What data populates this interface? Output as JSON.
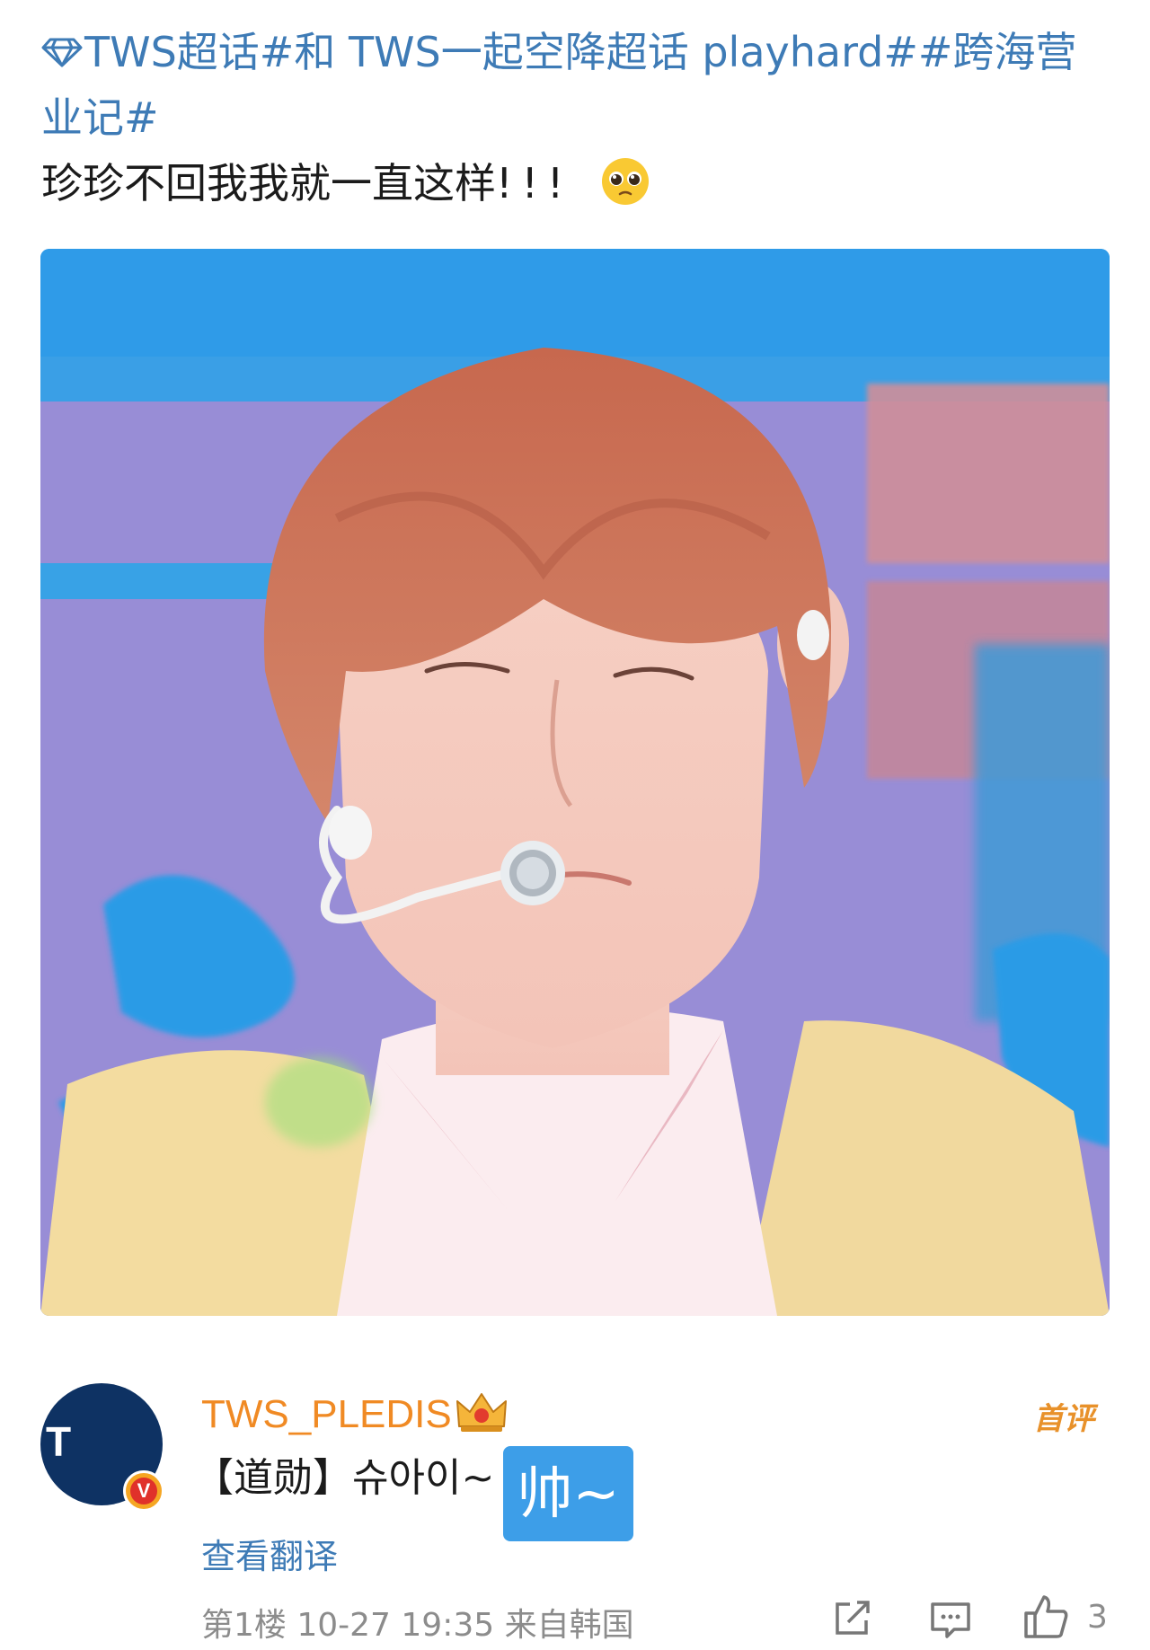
{
  "post": {
    "topic_line": "TWS超话#和 TWS一起空降超话 playhard##跨海营业记#",
    "text_main": "珍珍不回我我就一直这样",
    "text_excl": "!!!"
  },
  "comment": {
    "username": "TWS_PLEDIS",
    "first_badge": "首评",
    "avatar_text": "T",
    "verified_mark": "V",
    "body": "【道勋】슈아이~",
    "sticker_text": "帅~",
    "translate_link": "查看翻译",
    "meta": "第1楼 10-27 19:35 来自韩国",
    "like_count": "3"
  },
  "colors": {
    "topic": "#3e7bb6",
    "username": "#f08a24",
    "sticker": "#3d9ee8"
  },
  "icons": [
    "diamond-icon",
    "pleading-face-icon",
    "crown-icon",
    "verified-icon",
    "share-icon",
    "comment-icon",
    "like-icon"
  ]
}
